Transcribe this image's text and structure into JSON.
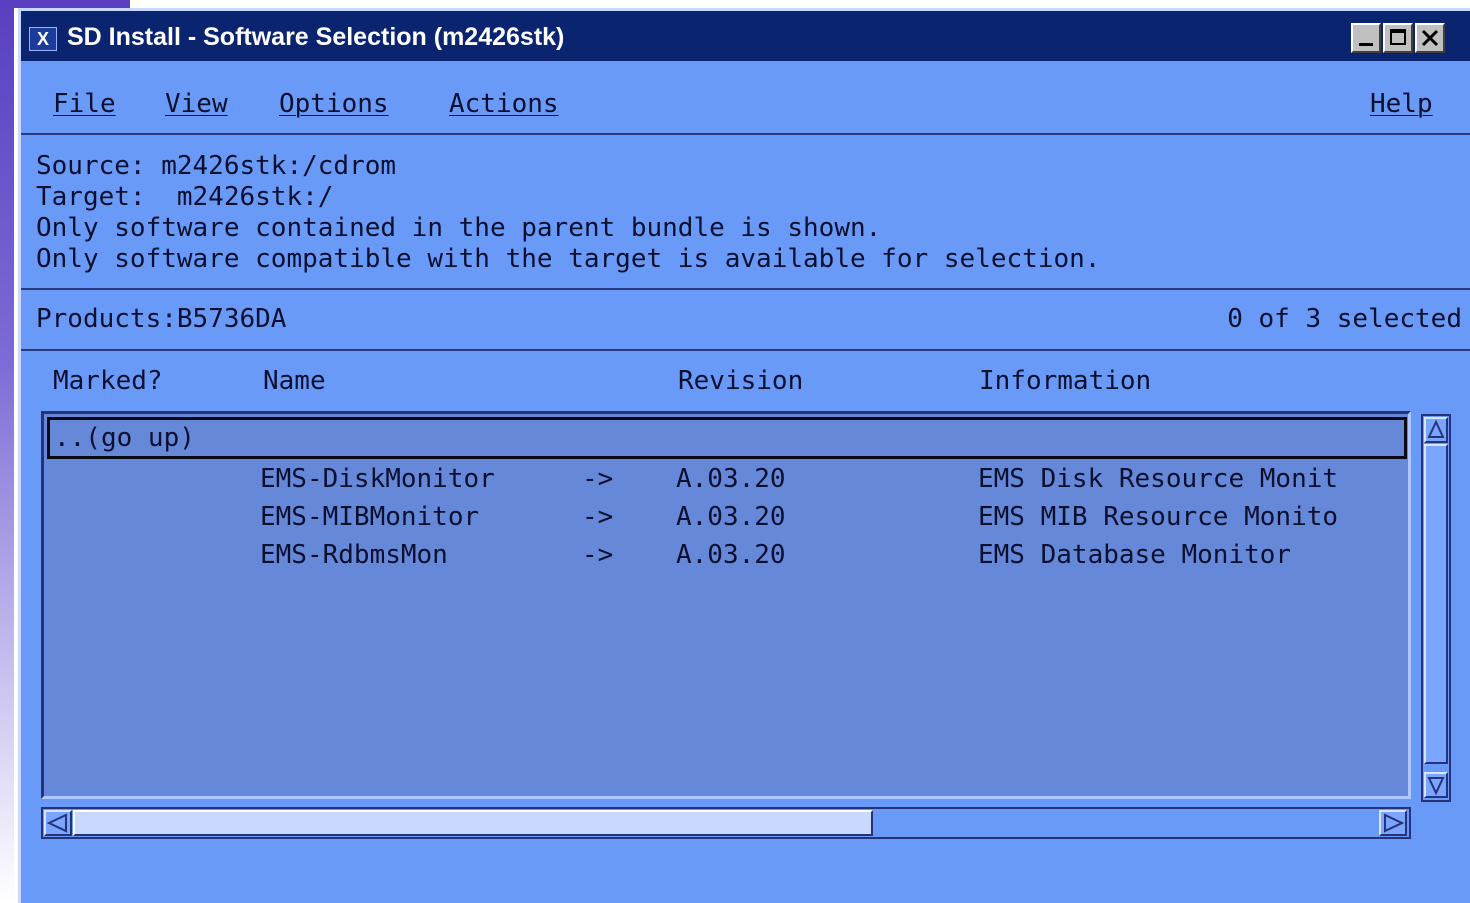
{
  "window": {
    "title": "SD Install - Software Selection (m2426stk)",
    "icon_label": "X",
    "buttons": {
      "minimize": "_",
      "maximize": "□",
      "close": "×"
    }
  },
  "menubar": {
    "file": "File",
    "view": "View",
    "options": "Options",
    "actions": "Actions",
    "help": "Help"
  },
  "info": {
    "source": "Source: m2426stk:/cdrom",
    "target": "Target:  m2426stk:/",
    "note1": "Only software contained in the parent bundle is shown.",
    "note2": "Only software compatible with the target is available for selection."
  },
  "products": {
    "label": "Products:B5736DA",
    "selected": "0 of 3 selected"
  },
  "columns": {
    "marked": "Marked?",
    "name": "Name",
    "revision": "Revision",
    "information": "Information"
  },
  "list": {
    "go_up": "..(go up)",
    "rows": [
      {
        "name": "EMS-DiskMonitor",
        "arrow": "->",
        "revision": "A.03.20",
        "information": "EMS Disk Resource Monit"
      },
      {
        "name": "EMS-MIBMonitor",
        "arrow": "->",
        "revision": "A.03.20",
        "information": "EMS MIB Resource Monito"
      },
      {
        "name": "EMS-RdbmsMon",
        "arrow": "->",
        "revision": "A.03.20",
        "information": "EMS Database Monitor"
      }
    ]
  },
  "colors": {
    "window_bg": "#6a9af8",
    "titlebar_bg": "#0a2470",
    "list_bg": "#6688d8",
    "text": "#0c1030"
  },
  "icons": [
    "x-window-icon",
    "minimize-icon",
    "maximize-icon",
    "close-icon",
    "scroll-up-icon",
    "scroll-down-icon",
    "scroll-left-icon",
    "scroll-right-icon"
  ]
}
